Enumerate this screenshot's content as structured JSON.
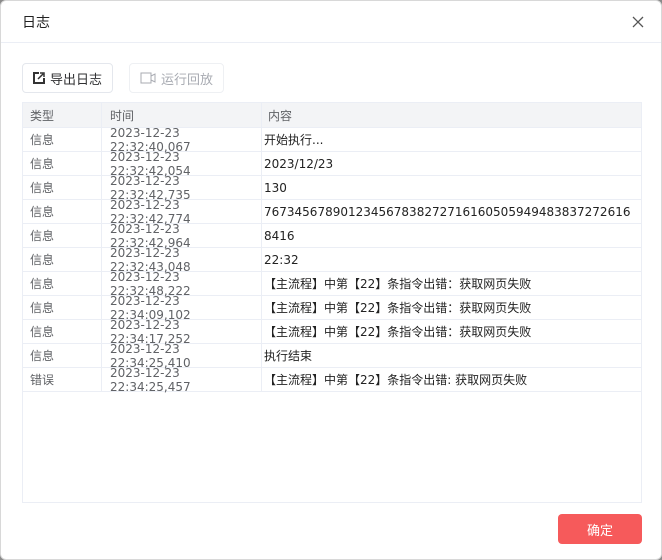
{
  "dialog": {
    "title": "日志",
    "confirm_label": "确定"
  },
  "toolbar": {
    "export_label": "导出日志",
    "replay_label": "运行回放"
  },
  "table": {
    "columns": [
      "类型",
      "时间",
      "内容"
    ],
    "rows": [
      {
        "type": "信息",
        "time": "2023-12-23 22:32:40,067",
        "content": "开始执行..."
      },
      {
        "type": "信息",
        "time": "2023-12-23 22:32:42,054",
        "content": "2023/12/23"
      },
      {
        "type": "信息",
        "time": "2023-12-23 22:32:42,735",
        "content": "130"
      },
      {
        "type": "信息",
        "time": "2023-12-23 22:32:42,774",
        "content": "767345678901234567838272716160505949483837272616"
      },
      {
        "type": "信息",
        "time": "2023-12-23 22:32:42,964",
        "content": "8416"
      },
      {
        "type": "信息",
        "time": "2023-12-23 22:32:43,048",
        "content": "22:32"
      },
      {
        "type": "信息",
        "time": "2023-12-23 22:32:48,222",
        "content": "【主流程】中第【22】条指令出错：获取网页失败"
      },
      {
        "type": "信息",
        "time": "2023-12-23 22:34:09,102",
        "content": "【主流程】中第【22】条指令出错：获取网页失败"
      },
      {
        "type": "信息",
        "time": "2023-12-23 22:34:17,252",
        "content": "【主流程】中第【22】条指令出错：获取网页失败"
      },
      {
        "type": "信息",
        "time": "2023-12-23 22:34:25,410",
        "content": "执行结束"
      },
      {
        "type": "错误",
        "time": "2023-12-23 22:34:25,457",
        "content": "【主流程】中第【22】条指令出错: 获取网页失败"
      }
    ]
  }
}
